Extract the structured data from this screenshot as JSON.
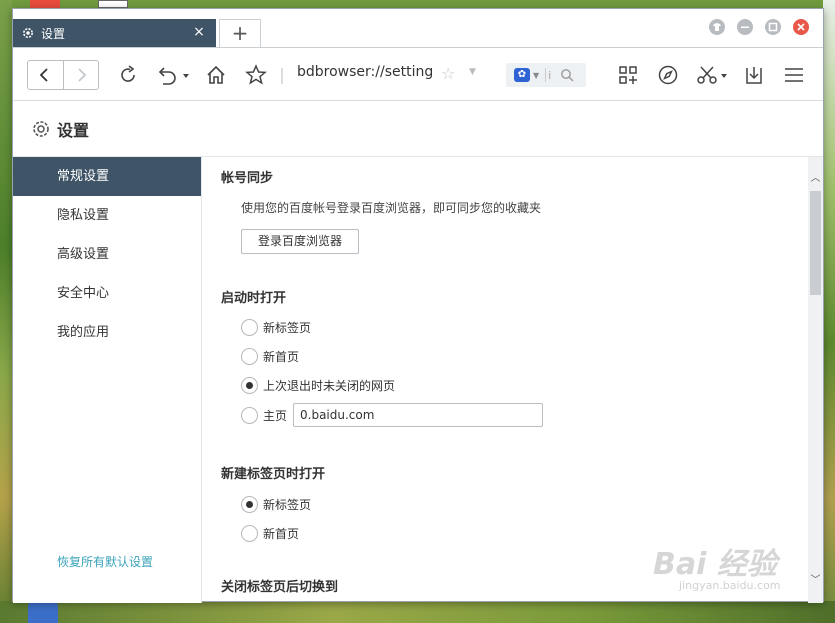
{
  "browser": {
    "tab_title": "设置",
    "tab_close": "×",
    "new_tab": "+",
    "url": "bdbrowser://settings"
  },
  "icons": {
    "back": "chevron-left-icon",
    "forward": "chevron-right-icon",
    "reload": "reload-icon",
    "undo": "undo-icon",
    "home": "home-icon",
    "star": "star-icon"
  },
  "search": {
    "placeholder": "i"
  },
  "settings": {
    "title": "设置",
    "sidebar": [
      {
        "label": "常规设置",
        "active": true
      },
      {
        "label": "隐私设置"
      },
      {
        "label": "高级设置"
      },
      {
        "label": "安全中心"
      },
      {
        "label": "我的应用"
      }
    ],
    "restore_defaults": "恢复所有默认设置",
    "sections": {
      "account_sync": {
        "title": "帐号同步",
        "desc": "使用您的百度帐号登录百度浏览器，即可同步您的收藏夹",
        "login_button": "登录百度浏览器"
      },
      "startup": {
        "title": "启动时打开",
        "options": [
          "新标签页",
          "新首页",
          "上次退出时未关闭的网页",
          "主页"
        ],
        "selected": 2,
        "homepage_value": "0.baidu.com"
      },
      "newtab": {
        "title": "新建标签页时打开",
        "options": [
          "新标签页",
          "新首页"
        ],
        "selected": 0
      },
      "close_tab": {
        "title": "关闭标签页后切换到"
      }
    }
  },
  "watermark": {
    "brand": "Bai 经验",
    "url": "jingyan.baidu.com"
  },
  "colors": {
    "sidebar_active": "#3f5466",
    "link": "#3aa3b8",
    "close": "#e8584a"
  }
}
